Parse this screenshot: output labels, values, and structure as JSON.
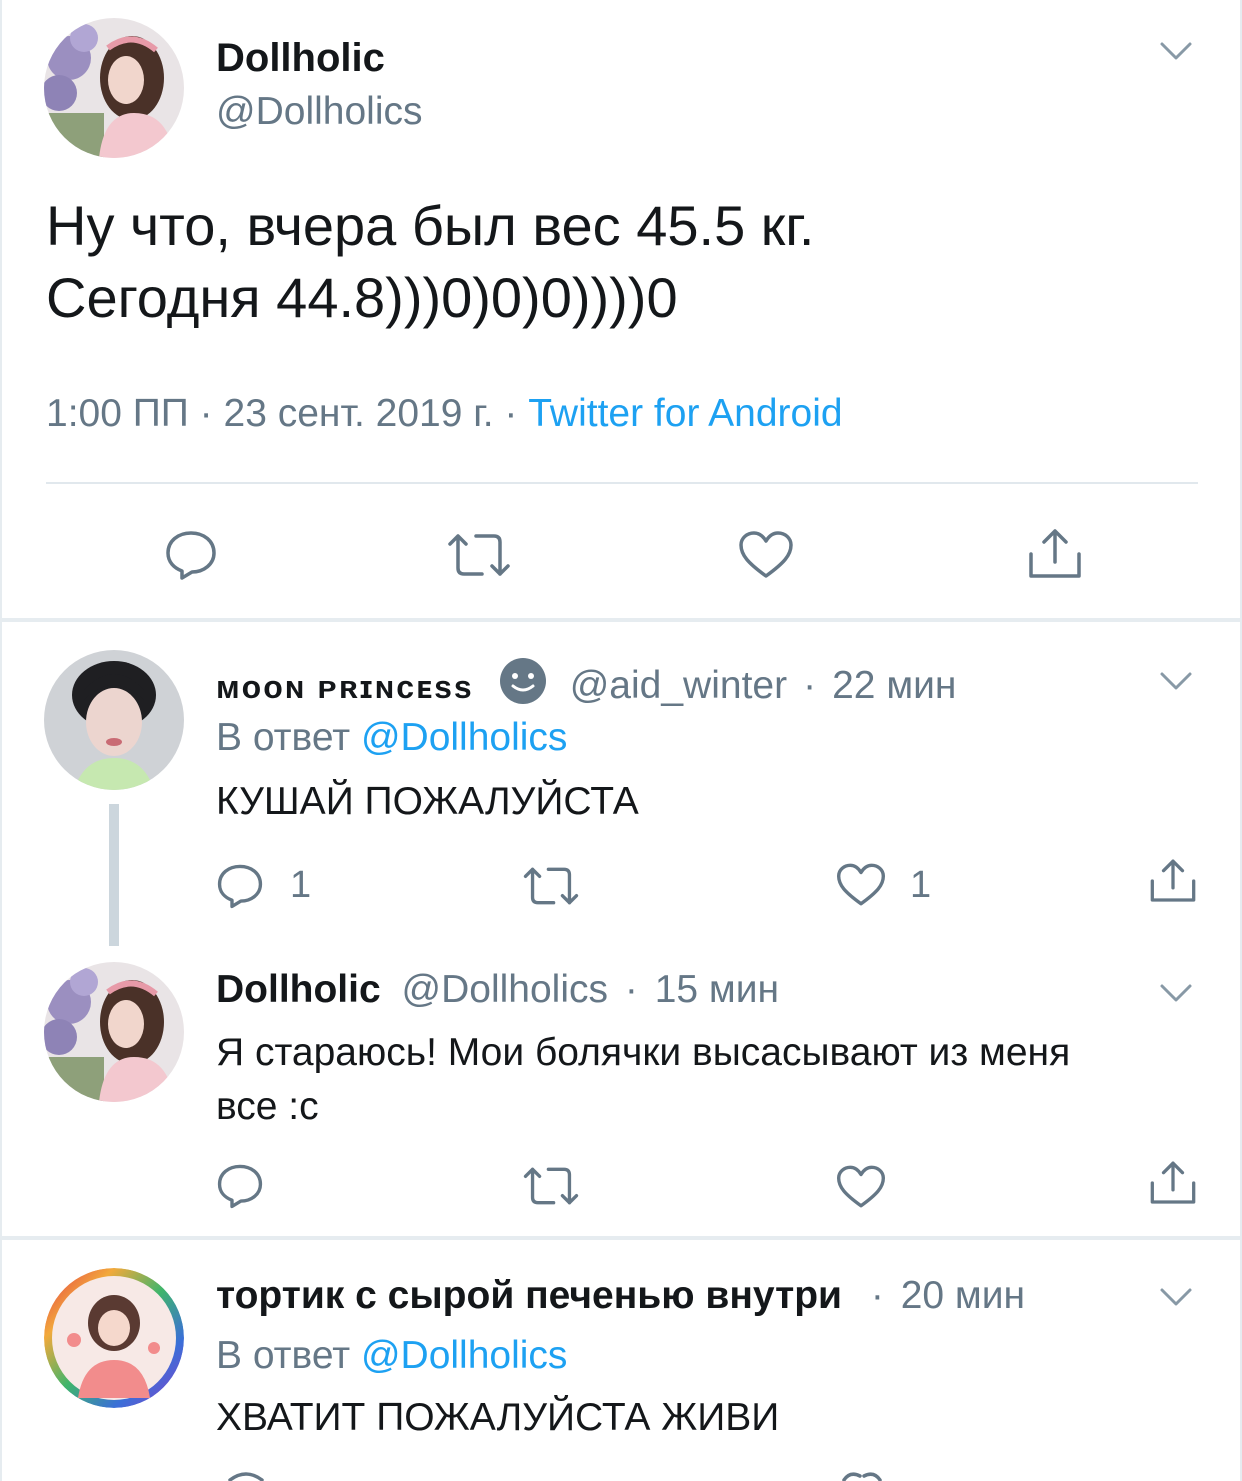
{
  "main_tweet": {
    "display_name": "Dollholic",
    "handle": "@Dollholics",
    "text_line1": "Ну что, вчера был вес 45.5 кг.",
    "text_line2": "Сегодня 44.8)))0)0)0))))0",
    "time": "1:00 ПП",
    "dot1": "·",
    "date": "23 сент. 2019 г.",
    "dot2": "·",
    "source": "Twitter for Android"
  },
  "replies": [
    {
      "display_name": "ᴍᴏᴏɴ ᴘʀɪɴᴄᴇss",
      "emoji": "smiley-emoji",
      "handle": "@aid_winter",
      "dot": "·",
      "time": "22 мин",
      "reply_to_prefix": "В ответ",
      "reply_to_handle": "@Dollholics",
      "text": "КУШАЙ ПОЖАЛУЙСТА",
      "reply_count": "1",
      "like_count": "1"
    },
    {
      "display_name": "Dollholic",
      "handle": "@Dollholics",
      "dot": "·",
      "time": "15 мин",
      "text_line1": "Я стараюсь! Мои болячки высасывают из меня",
      "text_line2": "все :с"
    },
    {
      "display_name": "тортик с сырой печенью внутри",
      "dot": "·",
      "time": "20 мин",
      "reply_to_prefix": "В ответ",
      "reply_to_handle": "@Dollholics",
      "text": "ХВАТИТ ПОЖАЛУЙСТА ЖИВИ"
    }
  ],
  "colors": {
    "accent": "#1da1f2",
    "secondary_text": "#657786",
    "icon_gray": "#657786",
    "divider": "#e6ecf0"
  }
}
